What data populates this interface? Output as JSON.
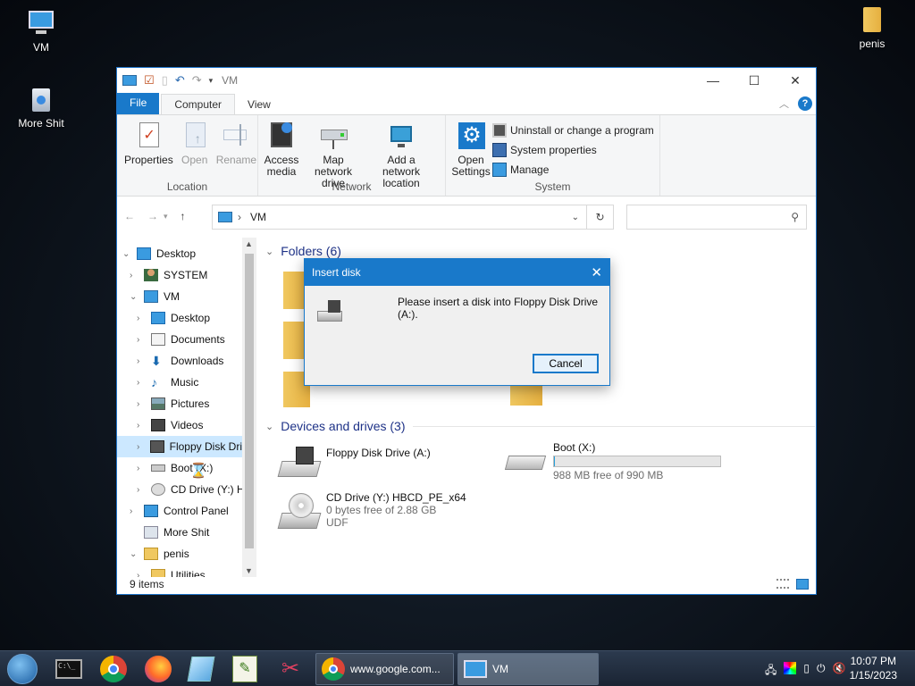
{
  "desktop": {
    "icons": [
      {
        "label": "VM"
      },
      {
        "label": "More Shit"
      },
      {
        "label": "penis"
      }
    ]
  },
  "window": {
    "title": "VM",
    "tabs": {
      "file": "File",
      "computer": "Computer",
      "view": "View"
    },
    "ribbon": {
      "location": {
        "label": "Location",
        "properties": "Properties",
        "open": "Open",
        "rename": "Rename"
      },
      "network": {
        "label": "Network",
        "access_media": "Access media",
        "map_drive": "Map network drive",
        "add_location": "Add a network location"
      },
      "system": {
        "label": "System",
        "open_settings": "Open Settings",
        "uninstall": "Uninstall or change a program",
        "system_properties": "System properties",
        "manage": "Manage"
      }
    },
    "address": {
      "path": "VM"
    },
    "nav": [
      {
        "label": "Desktop"
      },
      {
        "label": "SYSTEM"
      },
      {
        "label": "VM"
      },
      {
        "label": "Desktop"
      },
      {
        "label": "Documents"
      },
      {
        "label": "Downloads"
      },
      {
        "label": "Music"
      },
      {
        "label": "Pictures"
      },
      {
        "label": "Videos"
      },
      {
        "label": "Floppy Disk Dri"
      },
      {
        "label": "Boot (X:)"
      },
      {
        "label": "CD Drive (Y:) H"
      },
      {
        "label": "Control Panel"
      },
      {
        "label": "More Shit"
      },
      {
        "label": "penis"
      },
      {
        "label": "Utilities"
      }
    ],
    "content": {
      "folders_header": "Folders (6)",
      "devices_header": "Devices and drives (3)",
      "drives": [
        {
          "name": "Floppy Disk Drive (A:)"
        },
        {
          "name": "Boot (X:)",
          "free": "988 MB free of 990 MB",
          "used_fraction": 0.002
        },
        {
          "name": "CD Drive (Y:) HBCD_PE_x64",
          "free": "0 bytes free of 2.88 GB",
          "fs": "UDF"
        }
      ]
    },
    "status": "9 items"
  },
  "dialog": {
    "title": "Insert disk",
    "message": "Please insert a disk into Floppy Disk Drive (A:).",
    "cancel": "Cancel"
  },
  "taskbar": {
    "chrome_title": "www.google.com...",
    "vm_title": "VM",
    "time": "10:07 PM",
    "date": "1/15/2023"
  }
}
